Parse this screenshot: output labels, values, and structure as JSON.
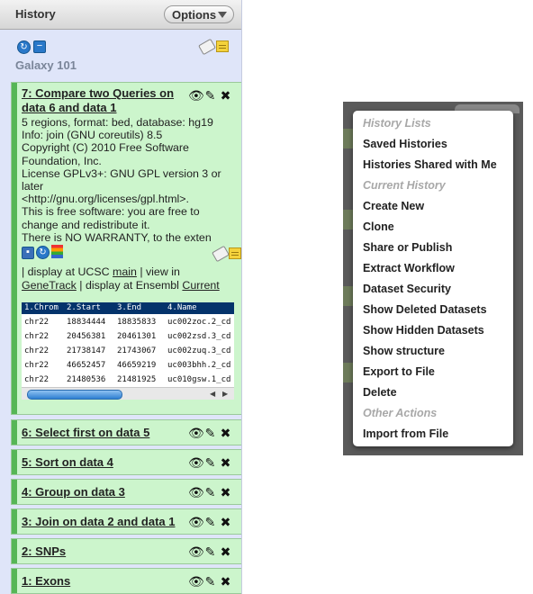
{
  "history": {
    "title": "History",
    "options_label": "Options",
    "name": "Galaxy 101",
    "datasets": [
      {
        "hid_title": "7: Compare two Queries on data 6 and data 1",
        "info_lines": [
          "5 regions, format: bed, database: hg19",
          "Info: join (GNU coreutils) 8.5",
          "Copyright (C) 2010 Free Software",
          "Foundation, Inc.",
          "License GPLv3+: GNU GPL version 3 or",
          "later",
          "<http://gnu.org/licenses/gpl.html>.",
          "This is free software: you are free to",
          "change and redistribute it.",
          "There is NO WARRANTY, to the exten"
        ],
        "display_prefix": "| display at UCSC",
        "link_main": "main",
        "link_view_in": "| view in",
        "link_genetrack": "GeneTrack",
        "display_ensembl": "| display at Ensembl",
        "link_current": "Current",
        "peek": {
          "columns": [
            "1.Chrom",
            "2.Start",
            "3.End",
            "4.Name"
          ],
          "rows": [
            [
              "chr22",
              "18834444",
              "18835833",
              "uc002zoc.2_cd"
            ],
            [
              "chr22",
              "20456381",
              "20461301",
              "uc002zsd.3_cd"
            ],
            [
              "chr22",
              "21738147",
              "21743067",
              "uc002zuq.3_cd"
            ],
            [
              "chr22",
              "46652457",
              "46659219",
              "uc003bhh.2_cd"
            ],
            [
              "chr22",
              "21480536",
              "21481925",
              "uc010gsw.1_cd"
            ]
          ]
        }
      },
      {
        "hid_title": "6: Select first on data 5"
      },
      {
        "hid_title": "5: Sort on data 4"
      },
      {
        "hid_title": "4: Group on data 3"
      },
      {
        "hid_title": "3: Join on data 2 and data 1"
      },
      {
        "hid_title": "2: SNPs"
      },
      {
        "hid_title": "1: Exons"
      }
    ],
    "icons": {
      "eye": "eye-icon",
      "edit": "pencil-icon",
      "delete": "x-icon",
      "refresh": "refresh-icon",
      "collapse": "collapse-icon",
      "tag": "tag-icon",
      "annotate": "note-icon"
    }
  },
  "menu": {
    "items": [
      {
        "type": "header",
        "label": "History Lists"
      },
      {
        "type": "item",
        "label": "Saved Histories"
      },
      {
        "type": "item",
        "label": "Histories Shared with Me"
      },
      {
        "type": "header",
        "label": "Current History"
      },
      {
        "type": "item",
        "label": "Create New"
      },
      {
        "type": "item",
        "label": "Clone"
      },
      {
        "type": "item",
        "label": "Share or Publish"
      },
      {
        "type": "item",
        "label": "Extract Workflow"
      },
      {
        "type": "item",
        "label": "Dataset Security"
      },
      {
        "type": "item",
        "label": "Show Deleted Datasets"
      },
      {
        "type": "item",
        "label": "Show Hidden Datasets"
      },
      {
        "type": "item",
        "label": "Show structure"
      },
      {
        "type": "item",
        "label": "Export to File"
      },
      {
        "type": "item",
        "label": "Delete"
      },
      {
        "type": "header",
        "label": "Other Actions"
      },
      {
        "type": "item",
        "label": "Import from File"
      }
    ]
  },
  "colors": {
    "dataset_ok_bg": "#ccf5cc",
    "dataset_ok_bar": "#56b656",
    "history_bg": "#dfe5f9",
    "peek_header": "#04336b"
  }
}
